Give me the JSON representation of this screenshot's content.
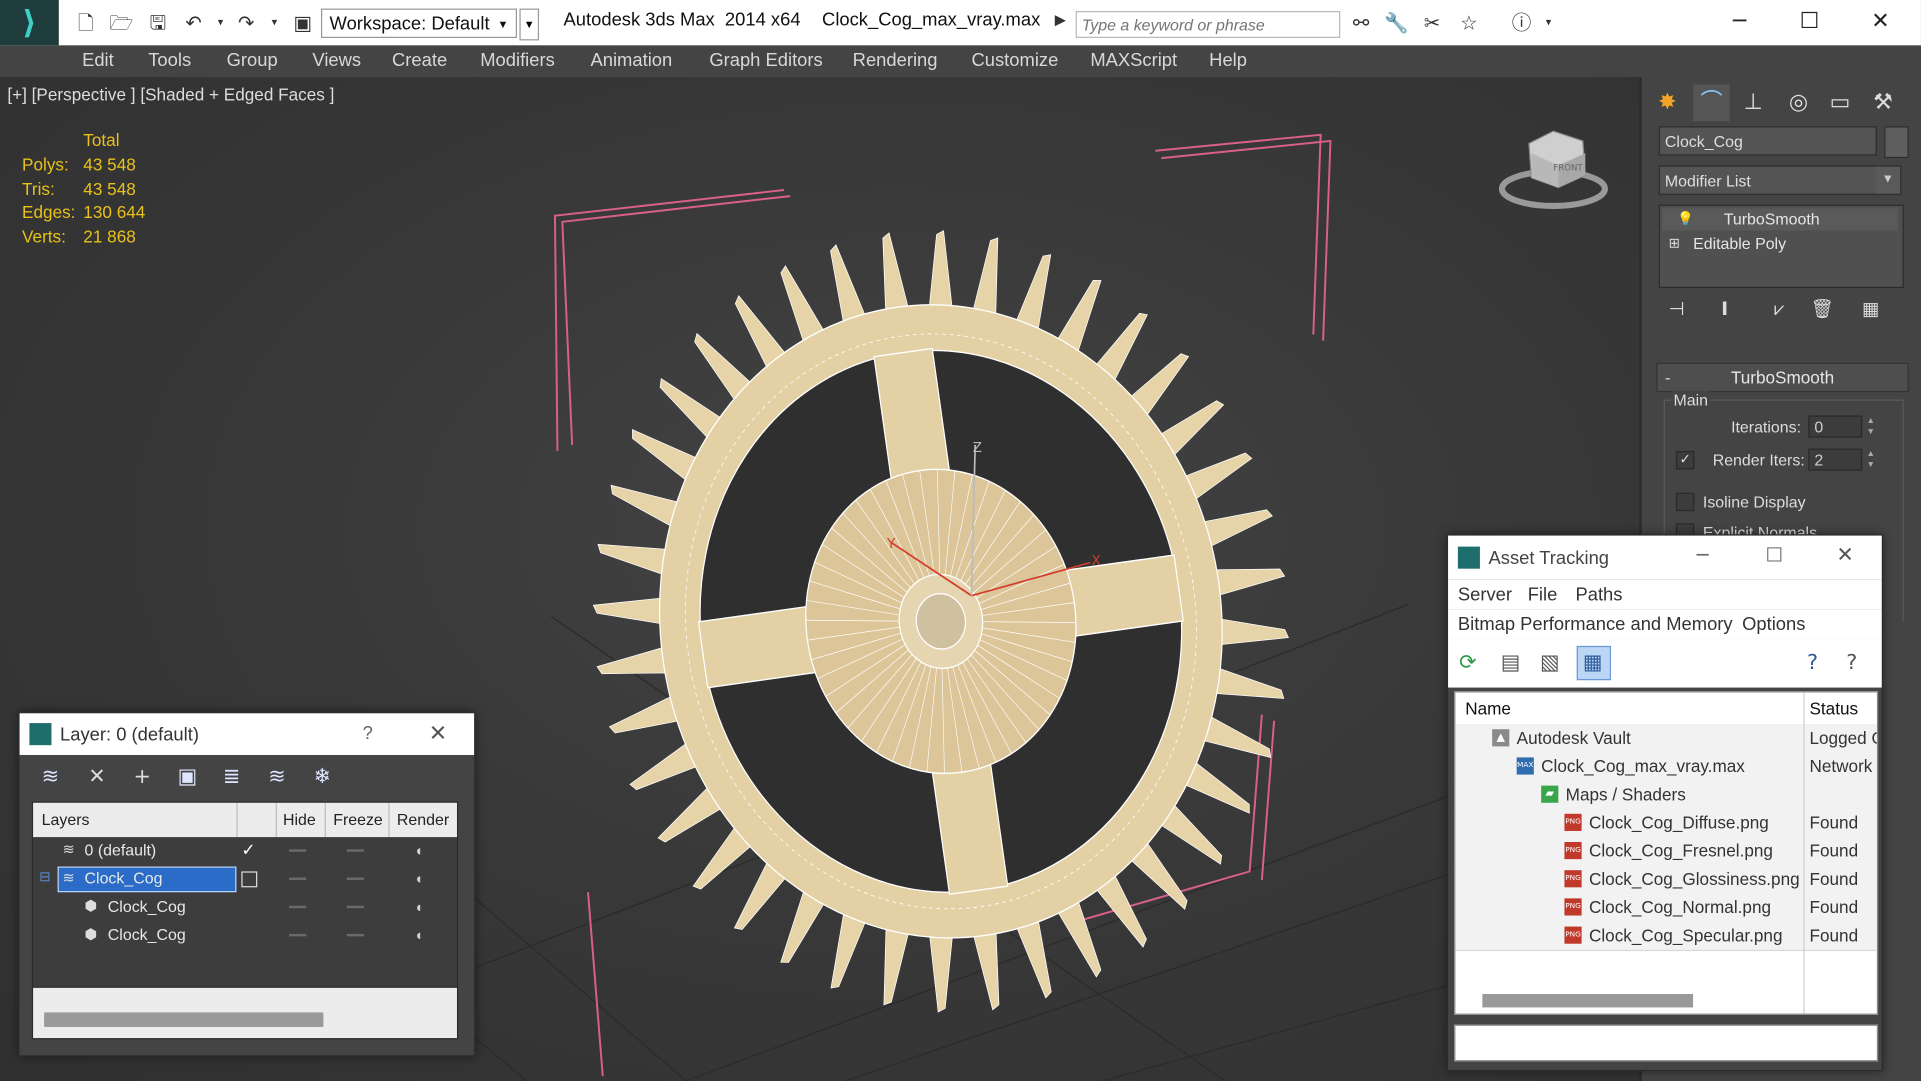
{
  "window": {
    "app_title": "Autodesk 3ds Max  2014 x64",
    "file_title": "Clock_Cog_max_vray.max",
    "workspace_label": "Workspace: Default",
    "search_placeholder": "Type a keyword or phrase",
    "logo": "3ds-max-logo"
  },
  "menu": [
    "Edit",
    "Tools",
    "Group",
    "Views",
    "Create",
    "Modifiers",
    "Animation",
    "Graph Editors",
    "Rendering",
    "Customize",
    "MAXScript",
    "Help"
  ],
  "viewport": {
    "label": "[+] [Perspective ] [Shaded + Edged Faces ]",
    "stats": {
      "header": "Total",
      "rows": [
        {
          "label": "Polys:",
          "value": "43 548"
        },
        {
          "label": "Tris:",
          "value": "43 548"
        },
        {
          "label": "Edges:",
          "value": "130 644"
        },
        {
          "label": "Verts:",
          "value": "21 868"
        }
      ]
    },
    "viewcube_label": "FRONT",
    "gizmo_x": "X",
    "gizmo_y": "Y",
    "gizmo_z": "Z"
  },
  "command_panel": {
    "object_name": "Clock_Cog",
    "modifier_list": "Modifier List",
    "stack": [
      {
        "label": "TurboSmooth",
        "selected": true
      },
      {
        "label": "Editable Poly",
        "selected": false
      }
    ],
    "rollout_title": "TurboSmooth",
    "group_main": "Main",
    "iterations_label": "Iterations:",
    "iterations_value": "0",
    "render_iters_label": "Render Iters:",
    "render_iters_value": "2",
    "render_iters_checked": true,
    "isoline_label": "Isoline Display",
    "explicit_label": "Explicit Normals"
  },
  "layer_dialog": {
    "title": "Layer: 0 (default)",
    "help": "?",
    "columns": [
      "Layers",
      "Hide",
      "Freeze",
      "Render"
    ],
    "rows": [
      {
        "name": "0 (default)",
        "current": true,
        "selected": false
      },
      {
        "name": "Clock_Cog",
        "current": false,
        "selected": true
      },
      {
        "name": "Clock_Cog",
        "current": false,
        "selected": false
      },
      {
        "name": "Clock_Cog",
        "current": false,
        "selected": false
      }
    ]
  },
  "asset_dialog": {
    "title": "Asset Tracking",
    "menu1": [
      "Server",
      "File",
      "Paths"
    ],
    "menu2": [
      "Bitmap Performance and Memory",
      "Options"
    ],
    "columns": [
      "Name",
      "Status"
    ],
    "rows": [
      {
        "name": "Autodesk Vault",
        "status": "Logged Out",
        "icon": "vault-icon"
      },
      {
        "name": "Clock_Cog_max_vray.max",
        "status": "Network",
        "icon": "max-file-icon"
      },
      {
        "name": "Maps / Shaders",
        "status": "",
        "icon": "maps-folder-icon"
      },
      {
        "name": "Clock_Cog_Diffuse.png",
        "status": "Found",
        "icon": "png-icon"
      },
      {
        "name": "Clock_Cog_Fresnel.png",
        "status": "Found",
        "icon": "png-icon"
      },
      {
        "name": "Clock_Cog_Glossiness.png",
        "status": "Found",
        "icon": "png-icon"
      },
      {
        "name": "Clock_Cog_Normal.png",
        "status": "Found",
        "icon": "png-icon"
      },
      {
        "name": "Clock_Cog_Specular.png",
        "status": "Found",
        "icon": "png-icon"
      }
    ]
  },
  "colors": {
    "stats_yellow": "#e8c11a",
    "selection_blue": "#2a6cc7",
    "gear_fill": "#e6d3a8",
    "bracket_pink": "#d9608a",
    "viewport_bg": "#3a3a3a"
  }
}
